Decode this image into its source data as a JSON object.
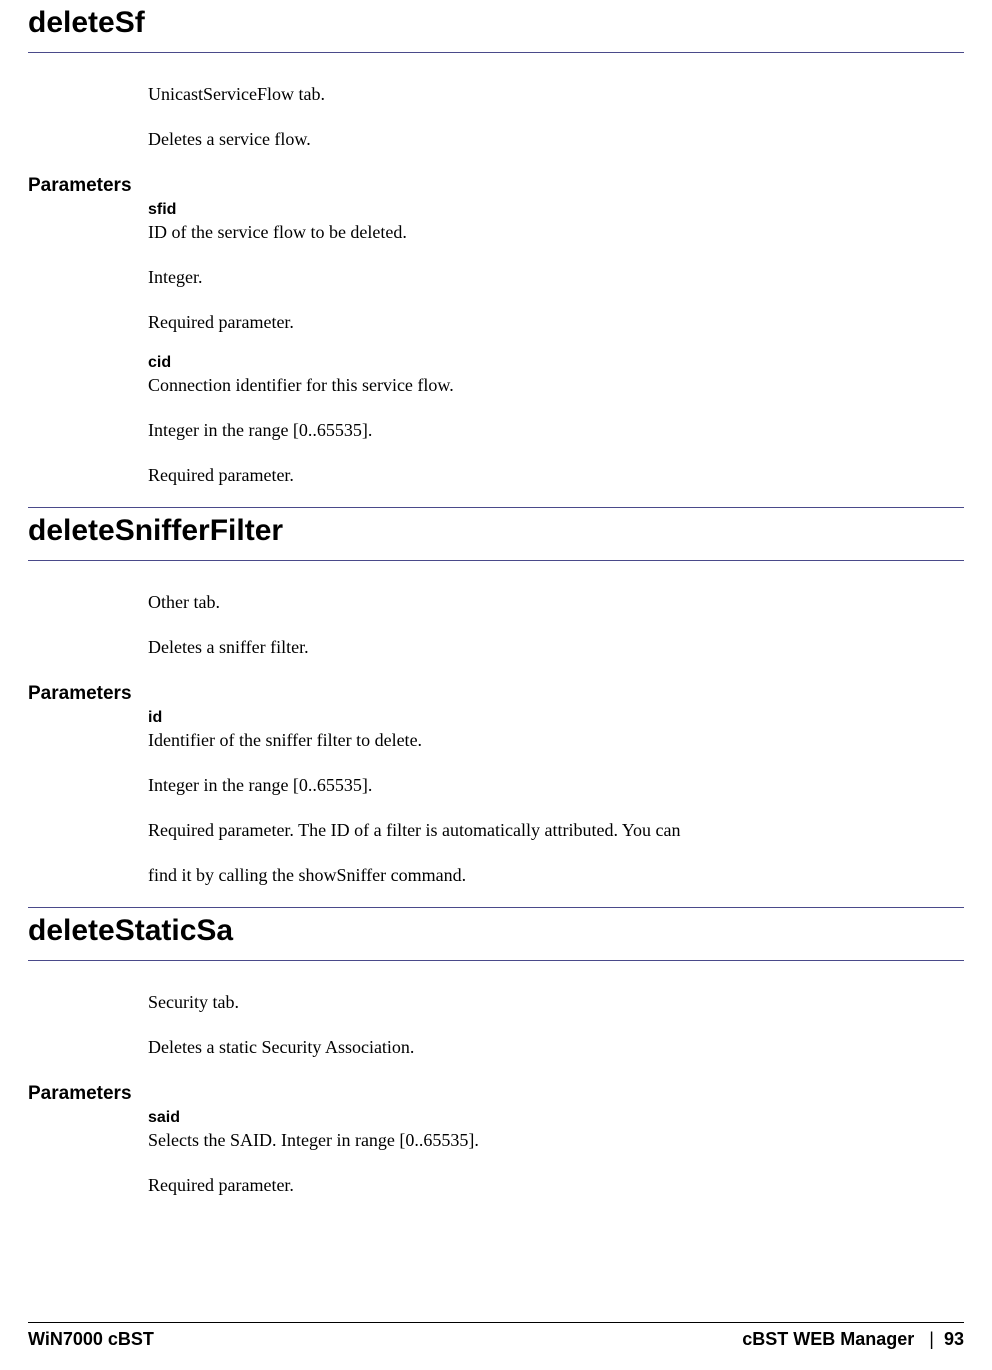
{
  "sections": [
    {
      "title": "deleteSf",
      "intro": [
        "UnicastServiceFlow tab.",
        "Deletes a service flow."
      ],
      "paramsLabel": "Parameters",
      "params": [
        {
          "name": "sfid",
          "lines": [
            "ID of the service flow to be deleted.",
            "Integer.",
            "Required parameter."
          ]
        },
        {
          "name": "cid",
          "lines": [
            "Connection identifier for this service flow.",
            "Integer in the range [0..65535].",
            "Required parameter."
          ]
        }
      ]
    },
    {
      "title": "deleteSnifferFilter",
      "intro": [
        "Other tab.",
        "Deletes a sniffer filter."
      ],
      "paramsLabel": "Parameters",
      "params": [
        {
          "name": "id",
          "lines": [
            "Identifier of the sniffer filter to delete.",
            "Integer in the range [0..65535].",
            "Required parameter. The ID of a filter is automatically attributed. You can",
            "find it by calling the showSniffer command."
          ]
        }
      ]
    },
    {
      "title": "deleteStaticSa",
      "intro": [
        "Security tab.",
        "Deletes a static Security Association."
      ],
      "paramsLabel": "Parameters",
      "params": [
        {
          "name": "said",
          "lines": [
            "Selects the SAID. Integer in range [0..65535].",
            "Required parameter."
          ]
        }
      ]
    }
  ],
  "footer": {
    "left": "WiN7000 cBST",
    "rightLabel": "cBST WEB Manager",
    "separator": "|",
    "pageNum": "93"
  }
}
